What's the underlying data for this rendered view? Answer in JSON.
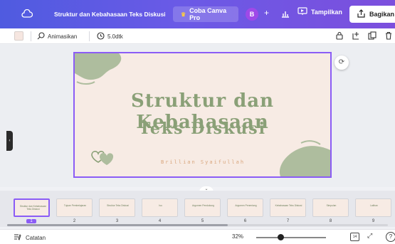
{
  "header": {
    "doc_title": "Struktur dan Kebahasaan Teks Diskusi",
    "pro_label": "Coba Canva Pro",
    "avatar_initial": "B",
    "plus": "+",
    "present_label": "Tampilkan",
    "share_label": "Bagikan",
    "colors": {
      "accent": "#6a5ae6",
      "avatar": "#9f49e8",
      "crown": "#f7c948"
    }
  },
  "toolbar": {
    "animate_label": "Animasikan",
    "duration_label": "5.0dtk"
  },
  "slide": {
    "title_line1": "Struktur dan Kebahasaan",
    "title_line2": "Teks Diskusi",
    "author": "Brillian Syaifullah",
    "colors": {
      "background": "#f7ebe4",
      "title": "#8aa077",
      "author": "#d9a67d",
      "selection": "#8b5cf6"
    }
  },
  "filmstrip": {
    "thumbs": [
      {
        "number": "1",
        "text": "Struktur dan Kebahasaan Teks Diskusi"
      },
      {
        "number": "2",
        "text": "Tujuan Pembelajaran"
      },
      {
        "number": "3",
        "text": "Struktur Teks Diskusi"
      },
      {
        "number": "4",
        "text": "Isu"
      },
      {
        "number": "5",
        "text": "Argumen Pendukung"
      },
      {
        "number": "6",
        "text": "Argumen Penentang"
      },
      {
        "number": "7",
        "text": "Kebahasaan Teks Diskusi"
      },
      {
        "number": "8",
        "text": "Simpulan"
      },
      {
        "number": "9",
        "text": "Latihan"
      }
    ],
    "active_index": 0,
    "scroll_fraction": 0.58
  },
  "bottombar": {
    "notes_label": "Catatan",
    "zoom_label": "32%",
    "page_badge": "14"
  }
}
